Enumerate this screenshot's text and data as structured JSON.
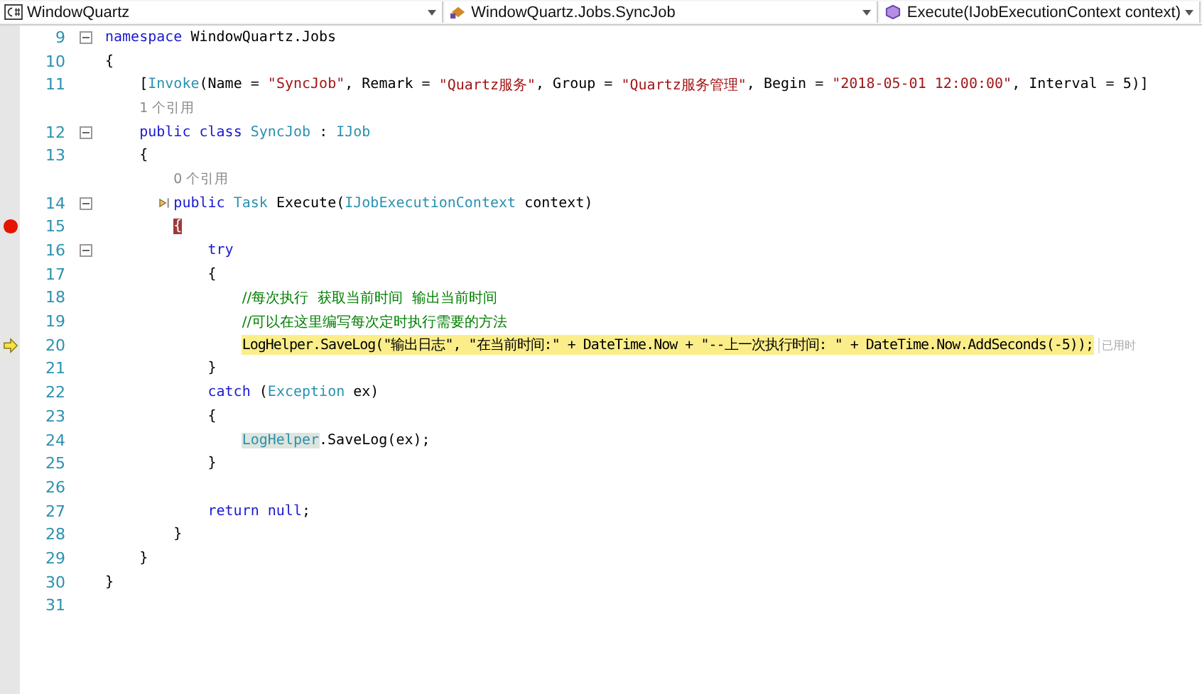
{
  "navigation_bar": [
    {
      "kind": "project",
      "text": "WindowQuartz"
    },
    {
      "kind": "class",
      "text": "WindowQuartz.Jobs.SyncJob"
    },
    {
      "kind": "method",
      "text": "Execute(IJobExecutionContext context)"
    }
  ],
  "lines": [
    {
      "number": "9",
      "fold": true,
      "tokens": [
        {
          "kind": "keyword",
          "text": "namespace"
        },
        {
          "kind": "plain",
          "text": " WindowQuartz.Jobs"
        }
      ]
    },
    {
      "number": "10",
      "tokens": [
        {
          "kind": "plain",
          "text": "{"
        }
      ]
    },
    {
      "number": "11",
      "tokens": [
        {
          "kind": "plain",
          "text": "    ["
        },
        {
          "kind": "type",
          "text": "Invoke"
        },
        {
          "kind": "plain",
          "text": "(Name = "
        },
        {
          "kind": "string",
          "text": "\"SyncJob\""
        },
        {
          "kind": "plain",
          "text": ", Remark = "
        },
        {
          "kind": "string",
          "text": "\"Quartz服务\""
        },
        {
          "kind": "plain",
          "text": ", Group = "
        },
        {
          "kind": "string",
          "text": "\"Quartz服务管理\""
        },
        {
          "kind": "plain",
          "text": ", Begin = "
        },
        {
          "kind": "string",
          "text": "\"2018-05-01 12:00:00\""
        },
        {
          "kind": "plain",
          "text": ", Interval = 5)]"
        }
      ]
    },
    {
      "tokens": [
        {
          "kind": "lens",
          "text": "    1 个引用"
        }
      ]
    },
    {
      "number": "12",
      "fold": true,
      "tokens": [
        {
          "kind": "keyword",
          "text": "    public class"
        },
        {
          "kind": "type",
          "text": " SyncJob"
        },
        {
          "kind": "plain",
          "text": " : "
        },
        {
          "kind": "type",
          "text": "IJob"
        }
      ]
    },
    {
      "number": "13",
      "tokens": [
        {
          "kind": "plain",
          "text": "    {"
        }
      ]
    },
    {
      "tokens": [
        {
          "kind": "lens",
          "text": "        0 个引用"
        }
      ]
    },
    {
      "number": "14",
      "fold": true,
      "quick_action": true,
      "tokens": [
        {
          "kind": "keyword",
          "text": "        public"
        },
        {
          "kind": "type",
          "text": " Task"
        },
        {
          "kind": "plain",
          "text": " Execute("
        },
        {
          "kind": "type",
          "text": "IJobExecutionContext"
        },
        {
          "kind": "plain",
          "text": " context)"
        }
      ]
    },
    {
      "number": "15",
      "breakpoint": true,
      "tokens": [
        {
          "kind": "breakpoint",
          "text": "        {"
        }
      ]
    },
    {
      "number": "16",
      "fold": true,
      "tokens": [
        {
          "kind": "keyword",
          "text": "            try"
        }
      ]
    },
    {
      "number": "17",
      "tokens": [
        {
          "kind": "plain",
          "text": "            {"
        }
      ]
    },
    {
      "number": "18",
      "tokens": [
        {
          "kind": "comment",
          "text": "                //每次执行  获取当前时间  输出当前时间"
        }
      ]
    },
    {
      "number": "19",
      "tokens": [
        {
          "kind": "comment",
          "text": "                //可以在这里编写每次定时执行需要的方法"
        }
      ]
    },
    {
      "number": "20",
      "current": true,
      "tokens": [
        {
          "kind": "statement",
          "text": "                LogHelper.SaveLog(\"输出日志\", \"在当前时间:\" + DateTime.Now + \"--上一次执行时间: \" + DateTime.Now.AddSeconds(-5));"
        },
        {
          "kind": "hint",
          "text": "已用时"
        }
      ]
    },
    {
      "number": "21",
      "tokens": [
        {
          "kind": "plain",
          "text": "            }"
        }
      ]
    },
    {
      "number": "22",
      "tokens": [
        {
          "kind": "keyword",
          "text": "            catch"
        },
        {
          "kind": "plain",
          "text": " ("
        },
        {
          "kind": "type",
          "text": "Exception"
        },
        {
          "kind": "plain",
          "text": " ex)"
        }
      ]
    },
    {
      "number": "23",
      "tokens": [
        {
          "kind": "plain",
          "text": "            {"
        }
      ]
    },
    {
      "number": "24",
      "tokens": [
        {
          "kind": "reference",
          "text": "                LogHelper"
        },
        {
          "kind": "plain",
          "text": ".SaveLog(ex);"
        }
      ]
    },
    {
      "number": "25",
      "tokens": [
        {
          "kind": "plain",
          "text": "            }"
        }
      ]
    },
    {
      "number": "26"
    },
    {
      "number": "27",
      "tokens": [
        {
          "kind": "keyword",
          "text": "            return null"
        },
        {
          "kind": "plain",
          "text": ";"
        }
      ]
    },
    {
      "number": "28",
      "tokens": [
        {
          "kind": "plain",
          "text": "        }"
        }
      ]
    },
    {
      "number": "29",
      "tokens": [
        {
          "kind": "plain",
          "text": "    }"
        }
      ]
    },
    {
      "number": "30",
      "tokens": [
        {
          "kind": "plain",
          "text": "}"
        }
      ]
    },
    {
      "number": "31"
    }
  ]
}
